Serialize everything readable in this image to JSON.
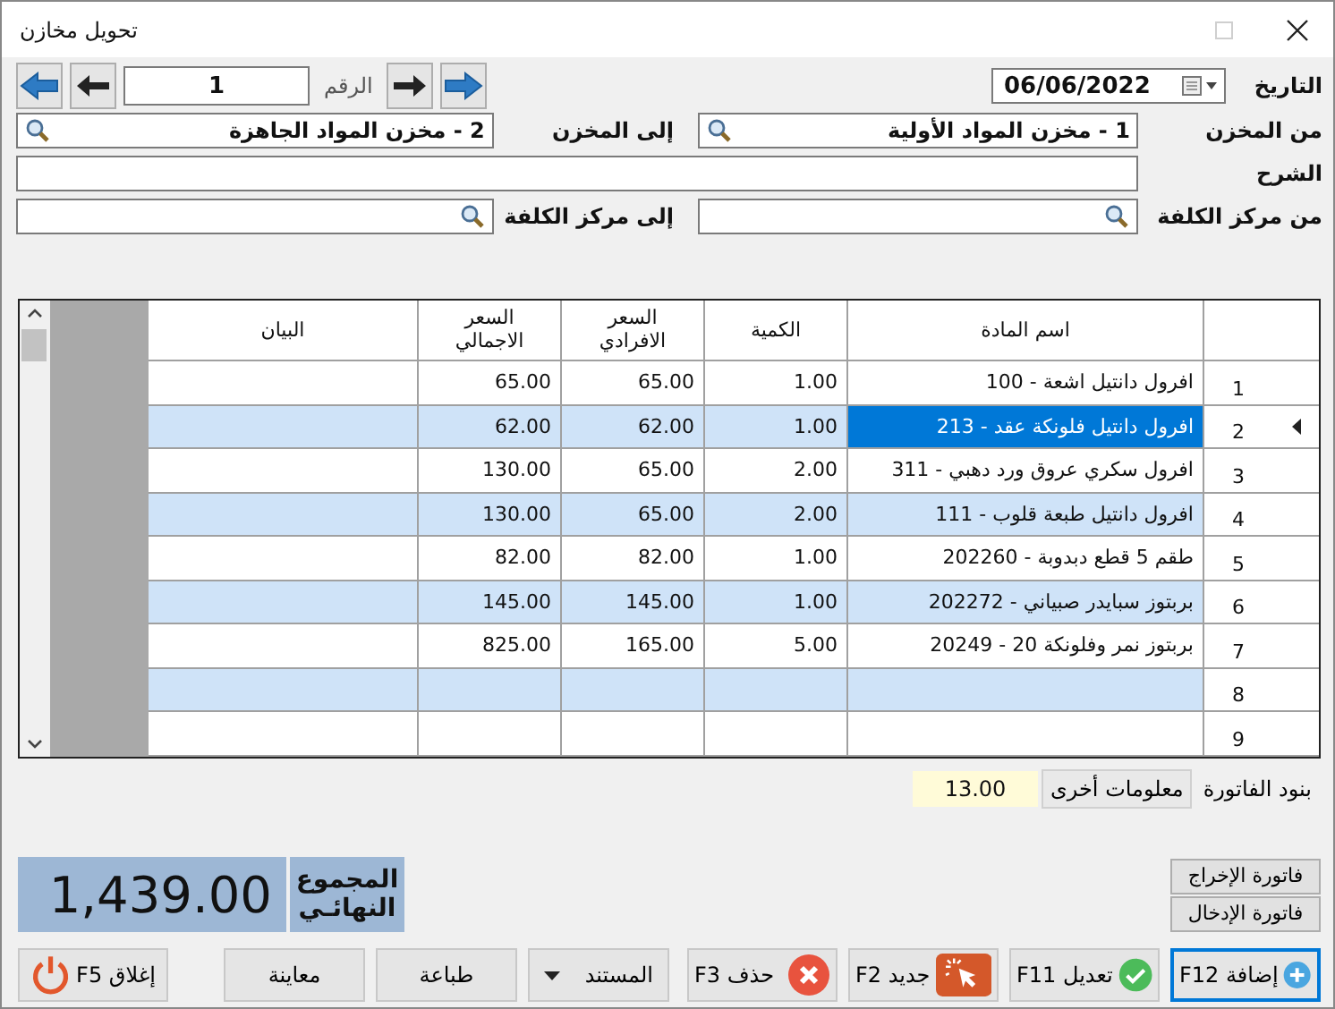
{
  "window": {
    "title": "تحويل مخازن"
  },
  "header": {
    "date_label": "التاريخ",
    "date": "06/06/2022",
    "number_label": "الرقم",
    "number": "1",
    "from_store": {
      "label": "من المخزن",
      "value": "1 - مخزن المواد الأولية"
    },
    "to_store": {
      "label": "إلى المخزن",
      "value": "2 - مخزن المواد الجاهزة"
    },
    "description": {
      "label": "الشرح"
    },
    "from_cost_center": {
      "label": "من مركز الكلفة"
    },
    "to_cost_center": {
      "label": "إلى مركز الكلفة"
    }
  },
  "table": {
    "columns": [
      "اسم المادة",
      "الكمية",
      "السعر الافرادي",
      "السعر الاجمالي",
      "البيان"
    ],
    "rows": [
      {
        "num": "1",
        "name": "100 - افرول دانتيل اشعة",
        "qty": "1.00",
        "unit": "65.00",
        "total": "65.00",
        "selected": false
      },
      {
        "num": "2",
        "name": "213 - افرول دانتيل فلونكة عقد",
        "qty": "1.00",
        "unit": "62.00",
        "total": "62.00",
        "selected": true
      },
      {
        "num": "3",
        "name": "311 - افرول سكري عروق ورد دهبي",
        "qty": "2.00",
        "unit": "65.00",
        "total": "130.00",
        "selected": false
      },
      {
        "num": "4",
        "name": "111 - افرول دانتيل طبعة قلوب",
        "qty": "2.00",
        "unit": "65.00",
        "total": "130.00",
        "selected": false
      },
      {
        "num": "5",
        "name": "202260 - طقم 5 قطع دبدوبة",
        "qty": "1.00",
        "unit": "82.00",
        "total": "82.00",
        "selected": false
      },
      {
        "num": "6",
        "name": "202272 - بربتوز سبايدر صبياني",
        "qty": "1.00",
        "unit": "145.00",
        "total": "145.00",
        "selected": false
      },
      {
        "num": "7",
        "name": "20249 - بربتوز نمر وفلونكة 20",
        "qty": "5.00",
        "unit": "165.00",
        "total": "825.00",
        "selected": false
      },
      {
        "num": "8",
        "selected": false
      },
      {
        "num": "9",
        "selected": false
      }
    ]
  },
  "tabs": [
    {
      "label": "بنود الفاتورة",
      "selected": true
    },
    {
      "label": "معلومات أخرى",
      "selected": false
    }
  ],
  "count": "13.00",
  "total": {
    "label": "المجموع النهائـي",
    "value": "1,439.00"
  },
  "side_buttons": [
    "فاتورة الإخراج",
    "فاتورة الإدخال"
  ],
  "actions": [
    {
      "kind": "add",
      "label": "إضافة F12",
      "focused": true
    },
    {
      "kind": "edit",
      "label": "تعديل F11",
      "focused": false
    },
    {
      "kind": "new",
      "label": "جديد F2",
      "focused": false
    },
    {
      "kind": "delete",
      "label": "حذف F3",
      "focused": false
    },
    {
      "kind": "dropdown",
      "label": "المستند",
      "focused": false
    },
    {
      "kind": "plain",
      "label": "طباعة",
      "focused": false
    },
    {
      "kind": "plain",
      "label": "معاينة",
      "focused": false
    },
    {
      "kind": "close",
      "label": "إغلاق F5",
      "focused": false
    }
  ]
}
